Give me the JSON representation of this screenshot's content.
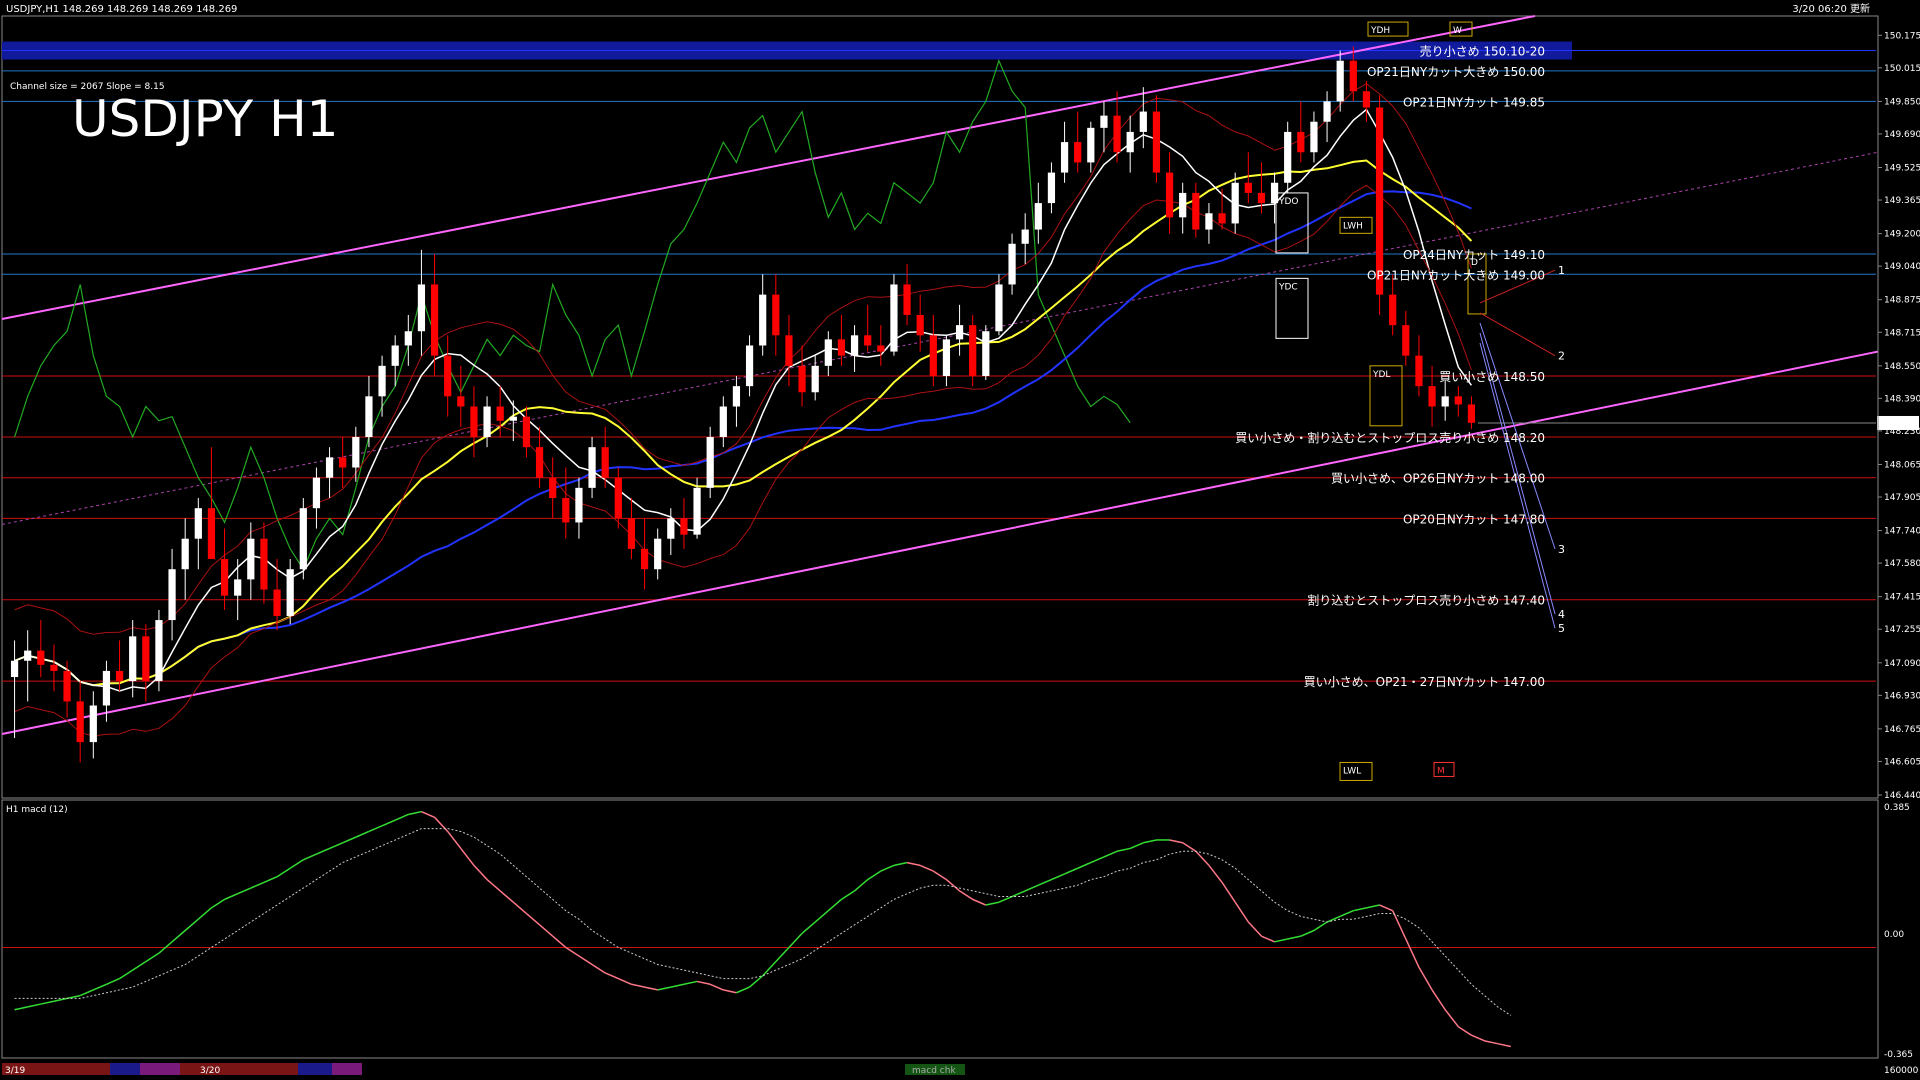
{
  "header": {
    "symbol_info": "USDJPY,H1  148.269 148.269 148.269 148.269",
    "datetime": "3/20 06:20 更新",
    "channel_info": "Channel size = 2067 Slope = 8.15",
    "big_title": "USDJPY H1"
  },
  "macd_panel": {
    "label": "H1  macd (12)",
    "top_value": "0.385",
    "zero_value": "0.00",
    "bottom_value": "-0.365",
    "bar_label": "macd chk"
  },
  "time_axis": {
    "label_left": "3/19",
    "label_mid": "3/20",
    "label_right": "160000"
  },
  "colors": {
    "background": "#000000",
    "bull_candle": "#ffffff",
    "bear_candle": "#ff0000",
    "channel": "#ff66ff",
    "sma_white": "#ffffff",
    "sma_yellow": "#ffff33",
    "sma_blue": "#2233ff",
    "chikou": "#22aa22",
    "level_blue": "#2277cc",
    "level_red": "#cc1111",
    "macd_up": "#33dd33",
    "macd_down": "#ff7788",
    "price_marker": "#ffffff"
  },
  "chart_data": {
    "type": "candlestick",
    "title": "USDJPY H1",
    "current_price": 148.269,
    "ylim": [
      146.44,
      150.26
    ],
    "y_ticks": [
      "150.175",
      "150.015",
      "149.850",
      "149.690",
      "149.525",
      "149.365",
      "149.200",
      "149.040",
      "148.875",
      "148.715",
      "148.550",
      "148.390",
      "148.230",
      "148.065",
      "147.905",
      "147.740",
      "147.580",
      "147.415",
      "147.255",
      "147.090",
      "146.930",
      "146.765",
      "146.605",
      "146.440"
    ],
    "levels": [
      {
        "price": 150.1,
        "label": "売り小さめ 150.10-20",
        "color": "#2233ff",
        "band": true
      },
      {
        "price": 150.0,
        "label": "OP21日NYカット大きめ 150.00",
        "color": "#2277cc"
      },
      {
        "price": 149.85,
        "label": "OP21日NYカット 149.85",
        "color": "#2277cc"
      },
      {
        "price": 149.1,
        "label": "OP24日NYカット 149.10",
        "color": "#2277cc"
      },
      {
        "price": 149.0,
        "label": "OP21日NYカット大きめ 149.00",
        "color": "#2277cc"
      },
      {
        "price": 148.5,
        "label": "買い小さめ 148.50",
        "color": "#cc1111"
      },
      {
        "price": 148.2,
        "label": "買い小さめ・割り込むとストップロス売り小さめ 148.20",
        "color": "#cc1111"
      },
      {
        "price": 148.0,
        "label": "買い小さめ、OP26日NYカット 148.00",
        "color": "#cc1111"
      },
      {
        "price": 147.8,
        "label": "OP20日NYカット 147.80",
        "color": "#cc1111"
      },
      {
        "price": 147.4,
        "label": "割り込むとストップロス売り小さめ 147.40",
        "color": "#cc1111"
      },
      {
        "price": 147.0,
        "label": "買い小さめ、OP21・27日NYカット 147.00",
        "color": "#cc1111"
      }
    ],
    "projection_labels": [
      "1",
      "2",
      "3",
      "4",
      "5"
    ],
    "boxes": [
      "YDH",
      "YDO",
      "YDC",
      "YDL",
      "LWL",
      "LWH",
      "W",
      "M",
      "D"
    ],
    "candles": [
      {
        "o": 147.02,
        "h": 147.2,
        "l": 146.72,
        "c": 147.1
      },
      {
        "o": 147.1,
        "h": 147.25,
        "l": 146.9,
        "c": 147.15
      },
      {
        "o": 147.15,
        "h": 147.3,
        "l": 147.02,
        "c": 147.08
      },
      {
        "o": 147.08,
        "h": 147.18,
        "l": 146.95,
        "c": 147.05
      },
      {
        "o": 147.05,
        "h": 147.1,
        "l": 146.82,
        "c": 146.9
      },
      {
        "o": 146.9,
        "h": 147.0,
        "l": 146.6,
        "c": 146.7
      },
      {
        "o": 146.7,
        "h": 146.95,
        "l": 146.62,
        "c": 146.88
      },
      {
        "o": 146.88,
        "h": 147.1,
        "l": 146.8,
        "c": 147.05
      },
      {
        "o": 147.05,
        "h": 147.2,
        "l": 146.95,
        "c": 147.0
      },
      {
        "o": 147.0,
        "h": 147.3,
        "l": 146.92,
        "c": 147.22
      },
      {
        "o": 147.22,
        "h": 147.28,
        "l": 146.9,
        "c": 147.0
      },
      {
        "o": 147.0,
        "h": 147.35,
        "l": 146.95,
        "c": 147.3
      },
      {
        "o": 147.3,
        "h": 147.65,
        "l": 147.2,
        "c": 147.55
      },
      {
        "o": 147.55,
        "h": 147.8,
        "l": 147.4,
        "c": 147.7
      },
      {
        "o": 147.7,
        "h": 147.9,
        "l": 147.55,
        "c": 147.85
      },
      {
        "o": 147.85,
        "h": 148.15,
        "l": 147.7,
        "c": 147.6
      },
      {
        "o": 147.6,
        "h": 147.75,
        "l": 147.35,
        "c": 147.42
      },
      {
        "o": 147.42,
        "h": 147.6,
        "l": 147.3,
        "c": 147.5
      },
      {
        "o": 147.5,
        "h": 147.78,
        "l": 147.4,
        "c": 147.7
      },
      {
        "o": 147.7,
        "h": 147.78,
        "l": 147.38,
        "c": 147.45
      },
      {
        "o": 147.45,
        "h": 147.6,
        "l": 147.25,
        "c": 147.32
      },
      {
        "o": 147.32,
        "h": 147.6,
        "l": 147.28,
        "c": 147.55
      },
      {
        "o": 147.55,
        "h": 147.9,
        "l": 147.5,
        "c": 147.85
      },
      {
        "o": 147.85,
        "h": 148.05,
        "l": 147.75,
        "c": 148.0
      },
      {
        "o": 148.0,
        "h": 148.15,
        "l": 147.9,
        "c": 148.1
      },
      {
        "o": 148.1,
        "h": 148.2,
        "l": 147.95,
        "c": 148.05
      },
      {
        "o": 148.05,
        "h": 148.25,
        "l": 147.98,
        "c": 148.2
      },
      {
        "o": 148.2,
        "h": 148.5,
        "l": 148.15,
        "c": 148.4
      },
      {
        "o": 148.4,
        "h": 148.6,
        "l": 148.3,
        "c": 148.55
      },
      {
        "o": 148.55,
        "h": 148.7,
        "l": 148.45,
        "c": 148.65
      },
      {
        "o": 148.65,
        "h": 148.8,
        "l": 148.55,
        "c": 148.72
      },
      {
        "o": 148.72,
        "h": 149.12,
        "l": 148.6,
        "c": 148.95
      },
      {
        "o": 148.95,
        "h": 149.1,
        "l": 148.5,
        "c": 148.6
      },
      {
        "o": 148.6,
        "h": 148.7,
        "l": 148.3,
        "c": 148.4
      },
      {
        "o": 148.4,
        "h": 148.55,
        "l": 148.25,
        "c": 148.35
      },
      {
        "o": 148.35,
        "h": 148.45,
        "l": 148.1,
        "c": 148.2
      },
      {
        "o": 148.2,
        "h": 148.4,
        "l": 148.15,
        "c": 148.35
      },
      {
        "o": 148.35,
        "h": 148.45,
        "l": 148.2,
        "c": 148.28
      },
      {
        "o": 148.28,
        "h": 148.38,
        "l": 148.18,
        "c": 148.3
      },
      {
        "o": 148.3,
        "h": 148.35,
        "l": 148.1,
        "c": 148.15
      },
      {
        "o": 148.15,
        "h": 148.25,
        "l": 147.95,
        "c": 148.0
      },
      {
        "o": 148.0,
        "h": 148.1,
        "l": 147.8,
        "c": 147.9
      },
      {
        "o": 147.9,
        "h": 148.05,
        "l": 147.7,
        "c": 147.78
      },
      {
        "o": 147.78,
        "h": 148.0,
        "l": 147.7,
        "c": 147.95
      },
      {
        "o": 147.95,
        "h": 148.2,
        "l": 147.9,
        "c": 148.15
      },
      {
        "o": 148.15,
        "h": 148.25,
        "l": 147.95,
        "c": 148.0
      },
      {
        "o": 148.0,
        "h": 148.05,
        "l": 147.75,
        "c": 147.8
      },
      {
        "o": 147.8,
        "h": 147.9,
        "l": 147.6,
        "c": 147.65
      },
      {
        "o": 147.65,
        "h": 147.8,
        "l": 147.45,
        "c": 147.55
      },
      {
        "o": 147.55,
        "h": 147.75,
        "l": 147.5,
        "c": 147.7
      },
      {
        "o": 147.7,
        "h": 147.85,
        "l": 147.62,
        "c": 147.8
      },
      {
        "o": 147.8,
        "h": 147.9,
        "l": 147.65,
        "c": 147.72
      },
      {
        "o": 147.72,
        "h": 148.0,
        "l": 147.7,
        "c": 147.95
      },
      {
        "o": 147.95,
        "h": 148.25,
        "l": 147.9,
        "c": 148.2
      },
      {
        "o": 148.2,
        "h": 148.4,
        "l": 148.15,
        "c": 148.35
      },
      {
        "o": 148.35,
        "h": 148.5,
        "l": 148.25,
        "c": 148.45
      },
      {
        "o": 148.45,
        "h": 148.7,
        "l": 148.4,
        "c": 148.65
      },
      {
        "o": 148.65,
        "h": 149.0,
        "l": 148.6,
        "c": 148.9
      },
      {
        "o": 148.9,
        "h": 149.0,
        "l": 148.6,
        "c": 148.7
      },
      {
        "o": 148.7,
        "h": 148.8,
        "l": 148.45,
        "c": 148.55
      },
      {
        "o": 148.55,
        "h": 148.65,
        "l": 148.35,
        "c": 148.42
      },
      {
        "o": 148.42,
        "h": 148.6,
        "l": 148.38,
        "c": 148.55
      },
      {
        "o": 148.55,
        "h": 148.72,
        "l": 148.5,
        "c": 148.68
      },
      {
        "o": 148.68,
        "h": 148.8,
        "l": 148.55,
        "c": 148.6
      },
      {
        "o": 148.6,
        "h": 148.75,
        "l": 148.52,
        "c": 148.7
      },
      {
        "o": 148.7,
        "h": 148.85,
        "l": 148.62,
        "c": 148.65
      },
      {
        "o": 148.65,
        "h": 148.75,
        "l": 148.55,
        "c": 148.62
      },
      {
        "o": 148.62,
        "h": 149.0,
        "l": 148.6,
        "c": 148.95
      },
      {
        "o": 148.95,
        "h": 149.05,
        "l": 148.75,
        "c": 148.8
      },
      {
        "o": 148.8,
        "h": 148.9,
        "l": 148.62,
        "c": 148.7
      },
      {
        "o": 148.7,
        "h": 148.8,
        "l": 148.45,
        "c": 148.5
      },
      {
        "o": 148.5,
        "h": 148.7,
        "l": 148.45,
        "c": 148.68
      },
      {
        "o": 148.68,
        "h": 148.85,
        "l": 148.6,
        "c": 148.75
      },
      {
        "o": 148.75,
        "h": 148.8,
        "l": 148.45,
        "c": 148.5
      },
      {
        "o": 148.5,
        "h": 148.75,
        "l": 148.48,
        "c": 148.72
      },
      {
        "o": 148.72,
        "h": 149.0,
        "l": 148.7,
        "c": 148.95
      },
      {
        "o": 148.95,
        "h": 149.2,
        "l": 148.9,
        "c": 149.15
      },
      {
        "o": 149.15,
        "h": 149.3,
        "l": 149.05,
        "c": 149.22
      },
      {
        "o": 149.22,
        "h": 149.45,
        "l": 149.15,
        "c": 149.35
      },
      {
        "o": 149.35,
        "h": 149.55,
        "l": 149.3,
        "c": 149.5
      },
      {
        "o": 149.5,
        "h": 149.75,
        "l": 149.45,
        "c": 149.65
      },
      {
        "o": 149.65,
        "h": 149.8,
        "l": 149.5,
        "c": 149.55
      },
      {
        "o": 149.55,
        "h": 149.75,
        "l": 149.5,
        "c": 149.72
      },
      {
        "o": 149.72,
        "h": 149.85,
        "l": 149.6,
        "c": 149.78
      },
      {
        "o": 149.78,
        "h": 149.9,
        "l": 149.55,
        "c": 149.6
      },
      {
        "o": 149.6,
        "h": 149.78,
        "l": 149.5,
        "c": 149.7
      },
      {
        "o": 149.7,
        "h": 149.92,
        "l": 149.62,
        "c": 149.8
      },
      {
        "o": 149.8,
        "h": 149.88,
        "l": 149.45,
        "c": 149.5
      },
      {
        "o": 149.5,
        "h": 149.6,
        "l": 149.2,
        "c": 149.28
      },
      {
        "o": 149.28,
        "h": 149.45,
        "l": 149.2,
        "c": 149.4
      },
      {
        "o": 149.4,
        "h": 149.45,
        "l": 149.18,
        "c": 149.22
      },
      {
        "o": 149.22,
        "h": 149.35,
        "l": 149.15,
        "c": 149.3
      },
      {
        "o": 149.3,
        "h": 149.42,
        "l": 149.22,
        "c": 149.25
      },
      {
        "o": 149.25,
        "h": 149.5,
        "l": 149.2,
        "c": 149.45
      },
      {
        "o": 149.45,
        "h": 149.6,
        "l": 149.35,
        "c": 149.4
      },
      {
        "o": 149.4,
        "h": 149.55,
        "l": 149.3,
        "c": 149.35
      },
      {
        "o": 149.35,
        "h": 149.5,
        "l": 149.25,
        "c": 149.45
      },
      {
        "o": 149.45,
        "h": 149.75,
        "l": 149.4,
        "c": 149.7
      },
      {
        "o": 149.7,
        "h": 149.85,
        "l": 149.55,
        "c": 149.6
      },
      {
        "o": 149.6,
        "h": 149.8,
        "l": 149.55,
        "c": 149.75
      },
      {
        "o": 149.75,
        "h": 149.9,
        "l": 149.65,
        "c": 149.85
      },
      {
        "o": 149.85,
        "h": 150.1,
        "l": 149.8,
        "c": 150.05
      },
      {
        "o": 150.05,
        "h": 150.12,
        "l": 149.85,
        "c": 149.9
      },
      {
        "o": 149.9,
        "h": 149.95,
        "l": 149.75,
        "c": 149.82
      },
      {
        "o": 149.82,
        "h": 149.88,
        "l": 148.8,
        "c": 148.9
      },
      {
        "o": 148.9,
        "h": 149.0,
        "l": 148.7,
        "c": 148.75
      },
      {
        "o": 148.75,
        "h": 148.82,
        "l": 148.55,
        "c": 148.6
      },
      {
        "o": 148.6,
        "h": 148.7,
        "l": 148.4,
        "c": 148.45
      },
      {
        "o": 148.45,
        "h": 148.55,
        "l": 148.25,
        "c": 148.35
      },
      {
        "o": 148.35,
        "h": 148.48,
        "l": 148.28,
        "c": 148.4
      },
      {
        "o": 148.4,
        "h": 148.45,
        "l": 148.3,
        "c": 148.36
      },
      {
        "o": 148.36,
        "h": 148.4,
        "l": 148.24,
        "c": 148.27
      }
    ],
    "macd": [
      -0.22,
      -0.21,
      -0.2,
      -0.19,
      -0.18,
      -0.17,
      -0.15,
      -0.13,
      -0.11,
      -0.08,
      -0.05,
      -0.02,
      0.02,
      0.06,
      0.1,
      0.14,
      0.17,
      0.19,
      0.21,
      0.23,
      0.25,
      0.28,
      0.31,
      0.33,
      0.35,
      0.37,
      0.39,
      0.41,
      0.43,
      0.45,
      0.47,
      0.48,
      0.46,
      0.41,
      0.35,
      0.29,
      0.24,
      0.2,
      0.16,
      0.12,
      0.08,
      0.04,
      0.0,
      -0.03,
      -0.06,
      -0.09,
      -0.11,
      -0.13,
      -0.14,
      -0.15,
      -0.14,
      -0.13,
      -0.12,
      -0.13,
      -0.15,
      -0.16,
      -0.14,
      -0.1,
      -0.05,
      0.0,
      0.05,
      0.09,
      0.13,
      0.17,
      0.2,
      0.24,
      0.27,
      0.29,
      0.3,
      0.29,
      0.27,
      0.24,
      0.2,
      0.17,
      0.15,
      0.16,
      0.18,
      0.2,
      0.22,
      0.24,
      0.26,
      0.28,
      0.3,
      0.32,
      0.34,
      0.35,
      0.37,
      0.38,
      0.38,
      0.37,
      0.34,
      0.29,
      0.23,
      0.16,
      0.09,
      0.04,
      0.02,
      0.03,
      0.04,
      0.06,
      0.09,
      0.11,
      0.13,
      0.14,
      0.15,
      0.13,
      0.03,
      -0.07,
      -0.15,
      -0.22,
      -0.28,
      -0.31,
      -0.33,
      -0.34,
      -0.35
    ],
    "macd_signal": [
      -0.18,
      -0.18,
      -0.18,
      -0.18,
      -0.18,
      -0.18,
      -0.17,
      -0.16,
      -0.15,
      -0.14,
      -0.12,
      -0.1,
      -0.08,
      -0.06,
      -0.03,
      0.0,
      0.03,
      0.06,
      0.09,
      0.12,
      0.15,
      0.18,
      0.21,
      0.24,
      0.27,
      0.3,
      0.32,
      0.34,
      0.36,
      0.38,
      0.4,
      0.42,
      0.42,
      0.42,
      0.41,
      0.39,
      0.36,
      0.33,
      0.29,
      0.25,
      0.21,
      0.17,
      0.13,
      0.1,
      0.06,
      0.03,
      0.0,
      -0.02,
      -0.04,
      -0.06,
      -0.07,
      -0.08,
      -0.09,
      -0.1,
      -0.11,
      -0.11,
      -0.11,
      -0.1,
      -0.08,
      -0.06,
      -0.04,
      -0.01,
      0.02,
      0.05,
      0.08,
      0.11,
      0.14,
      0.17,
      0.19,
      0.21,
      0.22,
      0.22,
      0.21,
      0.2,
      0.19,
      0.18,
      0.18,
      0.18,
      0.19,
      0.2,
      0.21,
      0.22,
      0.24,
      0.25,
      0.27,
      0.28,
      0.3,
      0.31,
      0.33,
      0.34,
      0.34,
      0.33,
      0.31,
      0.28,
      0.24,
      0.2,
      0.16,
      0.13,
      0.11,
      0.1,
      0.09,
      0.1,
      0.1,
      0.11,
      0.12,
      0.12,
      0.1,
      0.07,
      0.02,
      -0.03,
      -0.08,
      -0.13,
      -0.17,
      -0.21,
      -0.24
    ]
  }
}
